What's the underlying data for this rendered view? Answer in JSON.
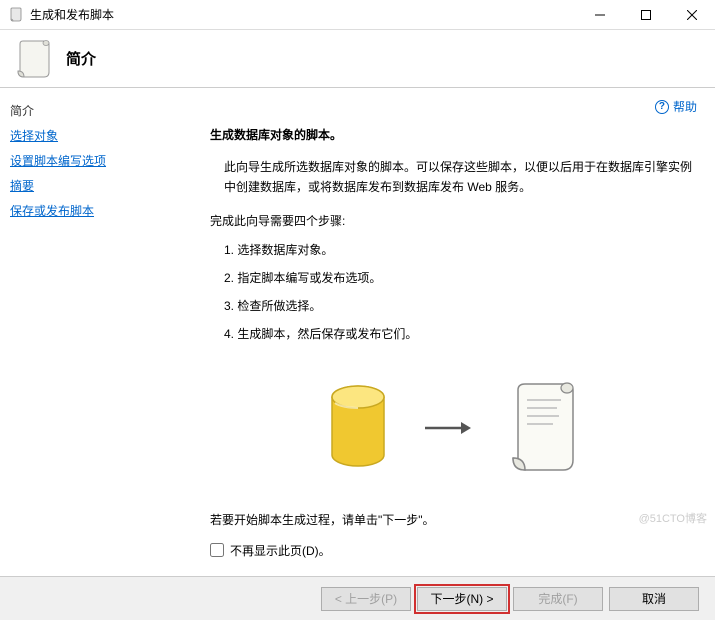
{
  "titlebar": {
    "title": "生成和发布脚本"
  },
  "header": {
    "title": "简介"
  },
  "sidebar": {
    "items": [
      {
        "label": "简介",
        "current": true
      },
      {
        "label": "选择对象",
        "current": false
      },
      {
        "label": "设置脚本编写选项",
        "current": false
      },
      {
        "label": "摘要",
        "current": false
      },
      {
        "label": "保存或发布脚本",
        "current": false
      }
    ]
  },
  "help": {
    "label": "帮助"
  },
  "content": {
    "section_title": "生成数据库对象的脚本。",
    "description": "此向导生成所选数据库对象的脚本。可以保存这些脚本，以便以后用于在数据库引擎实例中创建数据库，或将数据库发布到数据库发布 Web 服务。",
    "steps_intro": "完成此向导需要四个步骤:",
    "steps": [
      "1.  选择数据库对象。",
      "2.  指定脚本编写或发布选项。",
      "3.  检查所做选择。",
      "4.  生成脚本，然后保存或发布它们。"
    ],
    "prompt": "若要开始脚本生成过程，请单击\"下一步\"。",
    "checkbox_label": "不再显示此页(D)。"
  },
  "footer": {
    "prev": "< 上一步(P)",
    "next": "下一步(N) >",
    "finish": "完成(F)",
    "cancel": "取消"
  },
  "watermark": "@51CTO博客"
}
